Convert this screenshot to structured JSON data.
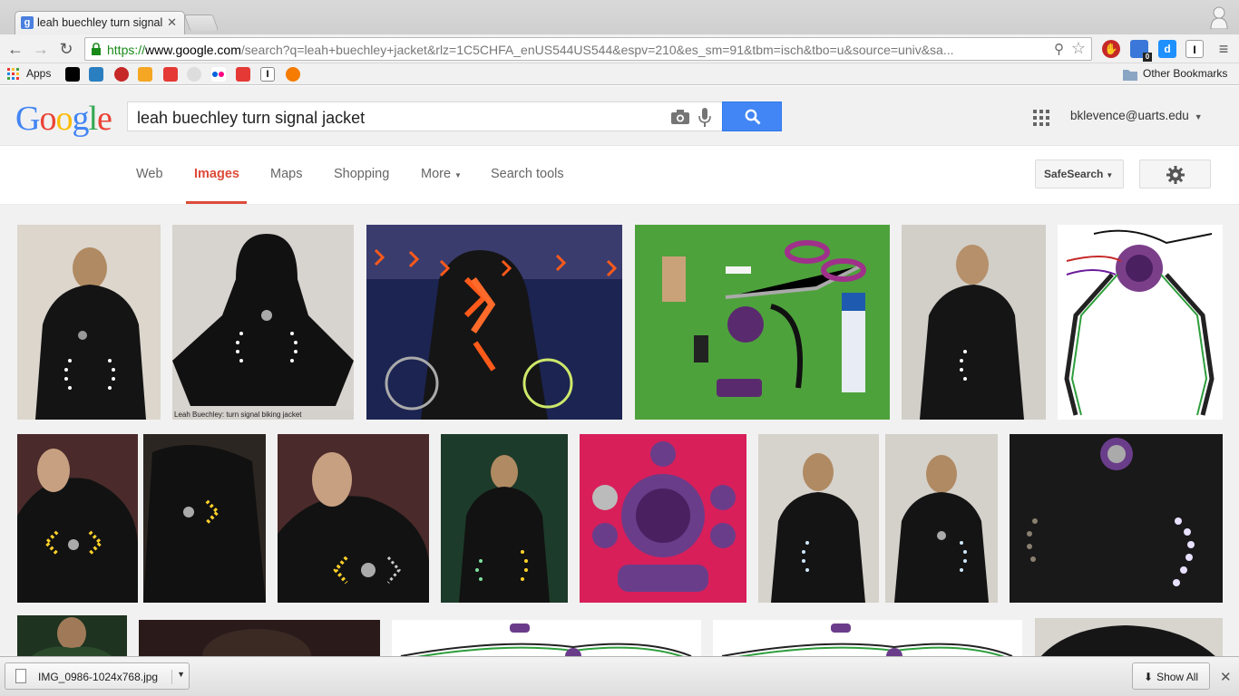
{
  "browser": {
    "tab_title": "leah buechley turn signal j",
    "tab_favicon": "g",
    "url_scheme": "https://",
    "url_host": "www.google.com",
    "url_rest": "/search?q=leah+buechley+jacket&rlz=1C5CHFA_enUS544US544&espv=210&es_sm=91&tbm=isch&tbo=u&source=univ&sa...",
    "ext_badge": "0",
    "ext_letter_i": "I"
  },
  "bookmarks": {
    "apps_label": "Apps",
    "other_label": "Other Bookmarks"
  },
  "google": {
    "logo": [
      "G",
      "o",
      "o",
      "g",
      "l",
      "e"
    ],
    "logo_colors": [
      "#4285f4",
      "#ea4335",
      "#fbbc05",
      "#4285f4",
      "#34a853",
      "#ea4335"
    ],
    "query": "leah buechley turn signal jacket",
    "account": "bklevence@uarts.edu"
  },
  "nav": {
    "tabs": [
      "Web",
      "Images",
      "Maps",
      "Shopping",
      "More",
      "Search tools"
    ],
    "active": "Images",
    "safesearch": "SafeSearch"
  },
  "results": {
    "caption": "Leah Buechley: turn signal biking jacket",
    "thumb_colors": [
      "#d8d2ca",
      "#d4d0cc",
      "#1e2a55",
      "#4aa13a",
      "#d0ccc6",
      "#ffffff",
      "#3a2a2a",
      "#2c2622",
      "#3b2b2b",
      "#1a3a2a",
      "#d8205a",
      "#d3cfc9",
      "#d1cdc7",
      "#1a1a1a",
      "#1e3320",
      "#2a1a1a",
      "#ffffff",
      "#ffffff",
      "#2a2a2a"
    ]
  },
  "downloads": {
    "file": "IMG_0986-1024x768.jpg",
    "show_all": "Show All"
  }
}
